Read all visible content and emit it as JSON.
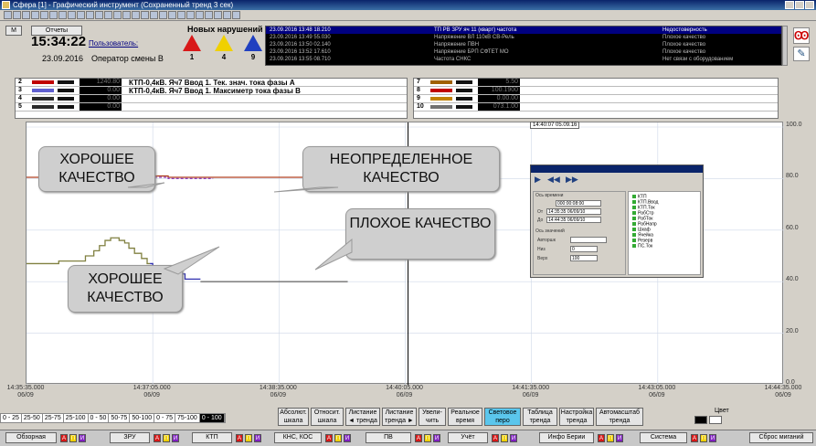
{
  "window": {
    "title": "Сфера [1] - Графический инструмент (Сохраненный тренд 3 сек)"
  },
  "status": {
    "reports_label": "Отчеты",
    "mode_label": "M",
    "time": "15:34:22",
    "user_label": "Пользователь:",
    "date": "23.09.2016",
    "operator": "Оператор смены",
    "operator_code": "В",
    "violations_title": "Новых нарушений",
    "violations": [
      {
        "count": "1",
        "color": "#d81818",
        "icon": "warning-triangle-red-icon"
      },
      {
        "count": "4",
        "color": "#f0d000",
        "icon": "warning-triangle-yellow-icon"
      },
      {
        "count": "9",
        "color": "#2040c0",
        "icon": "warning-triangle-blue-icon"
      }
    ]
  },
  "events": [
    {
      "time": "23.09.2016 13:48 18.210",
      "text": "ТП РВ ЗРУ яч 11 (кварт) частота",
      "status": "Недостоверность"
    },
    {
      "time": "23.09.2016 13:49 55.030",
      "text": "Напряжение ВЛ 110кВ СВ-Рель",
      "status": "Плохое качество"
    },
    {
      "time": "23.09.2016 13:50 02.140",
      "text": "Напряжение ПВН",
      "status": "Плохое качество"
    },
    {
      "time": "23.09.2016 13:52 17.610",
      "text": "Напряжение БРП СФТЕТ МО",
      "status": "Плохое качество"
    },
    {
      "time": "23.09.2016 13:55 08.710",
      "text": "Частота СНКС",
      "status": "Нет связи с оборудованием"
    }
  ],
  "legend_left": [
    {
      "num": "2",
      "color": "#c00000",
      "value": "1240.80",
      "desc": "КТП-0,4кВ. Яч7 Ввод 1. Тек. знач. тока фазы А"
    },
    {
      "num": "3",
      "color": "#6060d0",
      "value": "0.00",
      "desc": "КТП-0,4кВ. Яч7 Ввод 1. Максиметр тока фазы В"
    },
    {
      "num": "4",
      "color": "#2a2a2a",
      "value": "0.00",
      "desc": ""
    },
    {
      "num": "5",
      "color": "#2a2a2a",
      "value": "0.00",
      "desc": ""
    }
  ],
  "legend_right": [
    {
      "num": "7",
      "color": "#a06000",
      "value": "5.50"
    },
    {
      "num": "8",
      "color": "#c00000",
      "value": "100.1900"
    },
    {
      "num": "9",
      "color": "#c08000",
      "value": "0.00.00"
    },
    {
      "num": "10",
      "color": "#707070",
      "value": "073.1.00"
    }
  ],
  "callouts": {
    "good_top": "ХОРОШЕЕ КАЧЕСТВО",
    "undefined": "НЕОПРЕДЕЛЕННОЕ КАЧЕСТВО",
    "bad": "ПЛОХОЕ КАЧЕСТВО",
    "good_bottom": "ХОРОШЕЕ КАЧЕСТВО"
  },
  "dialog": {
    "interval_label": "Ось времени",
    "interval_value": "000:00:08:00",
    "from_label": "От",
    "from_value": "14:35:35 06/09/10",
    "to_label": "До",
    "to_value": "14:44:35 06/09/10",
    "values_label": "Ось значений",
    "auto_label": "Авторшк",
    "bottom_label": "Низ",
    "bottom_value": "0",
    "top_label": "Верх",
    "top_value": "100",
    "signals": [
      "КТП",
      "КТП.Ввод",
      "КТП.Ток",
      "РабСтр",
      "РабТок",
      "РабНапр",
      "Шкаф",
      "Ячейка",
      "Резерв",
      "ПС.Ток"
    ]
  },
  "chart_data": {
    "type": "line",
    "title": "",
    "xlabel": "",
    "ylabel": "",
    "ylim": [
      0,
      100
    ],
    "y_ticks": [
      "100.0",
      "80.0",
      "60.0",
      "40.0",
      "20.0",
      "0.0"
    ],
    "x_ticks": [
      {
        "time": "14:35:35.000",
        "date": "06/09"
      },
      {
        "time": "14:37:05.000",
        "date": "06/09"
      },
      {
        "time": "14:38:35.000",
        "date": "06/09"
      },
      {
        "time": "14:40:05.000",
        "date": "06/09"
      },
      {
        "time": "14:41:35.000",
        "date": "06/09"
      },
      {
        "time": "14:43:05.000",
        "date": "06/09"
      },
      {
        "time": "14:44:35.000",
        "date": "06/09"
      }
    ],
    "cursor_label": "14:40:07 05.09.16",
    "series": [
      {
        "color": "#b04020",
        "style": "solid",
        "points": [
          [
            0,
            80.5
          ],
          [
            33,
            80.5
          ],
          [
            33,
            81
          ],
          [
            66,
            81
          ],
          [
            66,
            81.5
          ],
          [
            88,
            81.5
          ],
          [
            88,
            81
          ],
          [
            101,
            81
          ],
          [
            101,
            80.5
          ],
          [
            229,
            80.5
          ]
        ]
      },
      {
        "color": "#9040c0",
        "style": "dashed",
        "points": [
          [
            88,
            80.5
          ],
          [
            101,
            80.5
          ],
          [
            101,
            80
          ],
          [
            133,
            80
          ]
        ]
      },
      {
        "color": "#808040",
        "style": "solid",
        "points": [
          [
            0,
            47
          ],
          [
            23,
            47
          ],
          [
            23,
            48
          ],
          [
            42,
            48
          ],
          [
            42,
            50
          ],
          [
            48,
            50
          ],
          [
            48,
            52
          ],
          [
            52,
            52
          ],
          [
            52,
            54
          ],
          [
            56,
            54
          ],
          [
            56,
            56
          ],
          [
            60,
            56
          ],
          [
            60,
            57
          ],
          [
            66,
            57
          ],
          [
            66,
            56
          ],
          [
            70,
            56
          ],
          [
            70,
            55
          ],
          [
            73,
            55
          ],
          [
            73,
            53
          ],
          [
            77,
            53
          ],
          [
            77,
            51
          ],
          [
            82,
            51
          ],
          [
            82,
            49
          ],
          [
            86,
            49
          ],
          [
            86,
            47
          ],
          [
            88,
            47
          ]
        ]
      },
      {
        "color": "#3030b0",
        "style": "solid",
        "points": [
          [
            88,
            47
          ],
          [
            90,
            47
          ],
          [
            90,
            41
          ],
          [
            99,
            41
          ],
          [
            99,
            43
          ],
          [
            103,
            43
          ],
          [
            103,
            44
          ],
          [
            105,
            44
          ],
          [
            105,
            43
          ],
          [
            113,
            43
          ],
          [
            113,
            41
          ],
          [
            124,
            41
          ]
        ]
      },
      {
        "color": "#707070",
        "style": "solid",
        "points": [
          [
            124,
            40
          ],
          [
            229,
            40
          ]
        ]
      }
    ]
  },
  "scale_buttons": [
    "0 - 25",
    "25-50",
    "25-75",
    "25-100",
    "0 - 50",
    "50-75",
    "50-100",
    "0 - 75",
    "75-100",
    "0 - 100"
  ],
  "mode_buttons": [
    {
      "label": "Абсолют. шкала",
      "active": false
    },
    {
      "label": "Относит. шкала",
      "active": false
    },
    {
      "label": "Листание ◄ тренда",
      "active": false
    },
    {
      "label": "Листание тренда ►",
      "active": false
    },
    {
      "label": "Увели-чить",
      "active": false
    },
    {
      "label": "Реальное время",
      "active": false
    },
    {
      "label": "Световое перо",
      "active": true
    },
    {
      "label": "Таблица тренда",
      "active": false
    },
    {
      "label": "Настройка тренда",
      "active": false
    },
    {
      "label": "Автомасштаб тренда",
      "active": false
    }
  ],
  "color_label": "Цвет",
  "bottom_bar": [
    {
      "label": "Обзорная"
    },
    {
      "label": "ЗРУ"
    },
    {
      "label": "КТП"
    },
    {
      "label": "КНС, КОС"
    },
    {
      "label": "ПВ"
    },
    {
      "label": "Учёт"
    },
    {
      "label": "Инфо Берии"
    },
    {
      "label": "Система"
    }
  ],
  "reset_label": "Сброс миганий",
  "indicator_letters": {
    "a": "А",
    "p": "П",
    "i": "И"
  }
}
